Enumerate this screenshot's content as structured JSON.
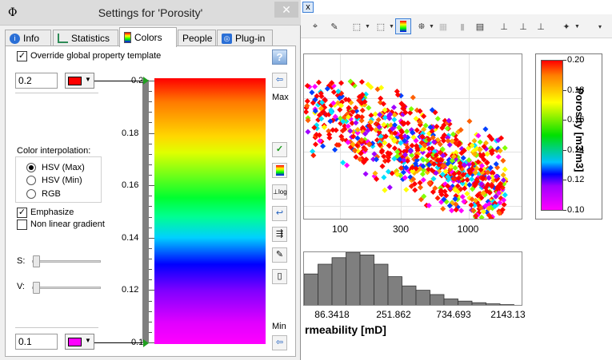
{
  "window": {
    "title": "Settings for 'Porosity'",
    "icon_glyph": "Φ",
    "close_glyph": "✕"
  },
  "tabs": [
    {
      "label": "Info",
      "icon": "info-icon",
      "color": "#2a6fd6"
    },
    {
      "label": "Statistics",
      "icon": "statistics-icon",
      "color": "#2e8b57"
    },
    {
      "label": "Colors",
      "icon": "colors-icon",
      "color": "#1fa01f"
    },
    {
      "label": "People",
      "icon": "people-icon",
      "color": "#777777"
    },
    {
      "label": "Plug-in",
      "icon": "plugin-icon",
      "color": "#2a6fd6"
    }
  ],
  "active_tab": "Colors",
  "colors_panel": {
    "override_label": "Override global property template",
    "override_checked": true,
    "help_label": "?",
    "max_value": "0.2",
    "max_color": "#ff0000",
    "min_value": "0.1",
    "min_color": "#ff00ff",
    "max_label": "Max",
    "min_label": "Min",
    "ruler_labels": [
      "0.2",
      "0.18",
      "0.16",
      "0.14",
      "0.12",
      "0.1"
    ],
    "interpolation_heading": "Color interpolation:",
    "interpolation_options": [
      "HSV (Max)",
      "HSV (Min)",
      "RGB"
    ],
    "interpolation_selected": "HSV (Max)",
    "emphasize_label": "Emphasize",
    "emphasize_checked": true,
    "nonlinear_label": "Non linear gradient",
    "nonlinear_checked": false,
    "s_label": "S:",
    "v_label": "V:",
    "side_buttons": [
      "apply-check-icon",
      "color-table-icon",
      "log-scale-icon",
      "flip-icon",
      "copy-colors-icon",
      "edit-colors-icon",
      "blank-page-icon"
    ]
  },
  "background_app": {
    "menu_fragment": "x",
    "crossplot": {
      "x_ticks": [
        "100",
        "300",
        "1000"
      ],
      "legend": {
        "title": "Porosity [m3/m3]",
        "labels": [
          "0.20",
          "0.18",
          "0.16",
          "0.14",
          "0.12",
          "0.10"
        ]
      }
    },
    "histogram": {
      "x_ticks": [
        "86.3418",
        "251.862",
        "734.693",
        "2143.13"
      ],
      "xlabel": "rmeability [mD]",
      "bars_relative": [
        0.6,
        0.78,
        0.9,
        1.0,
        0.95,
        0.78,
        0.55,
        0.38,
        0.3,
        0.22,
        0.14,
        0.1,
        0.07,
        0.05,
        0.035,
        0.02
      ]
    }
  }
}
